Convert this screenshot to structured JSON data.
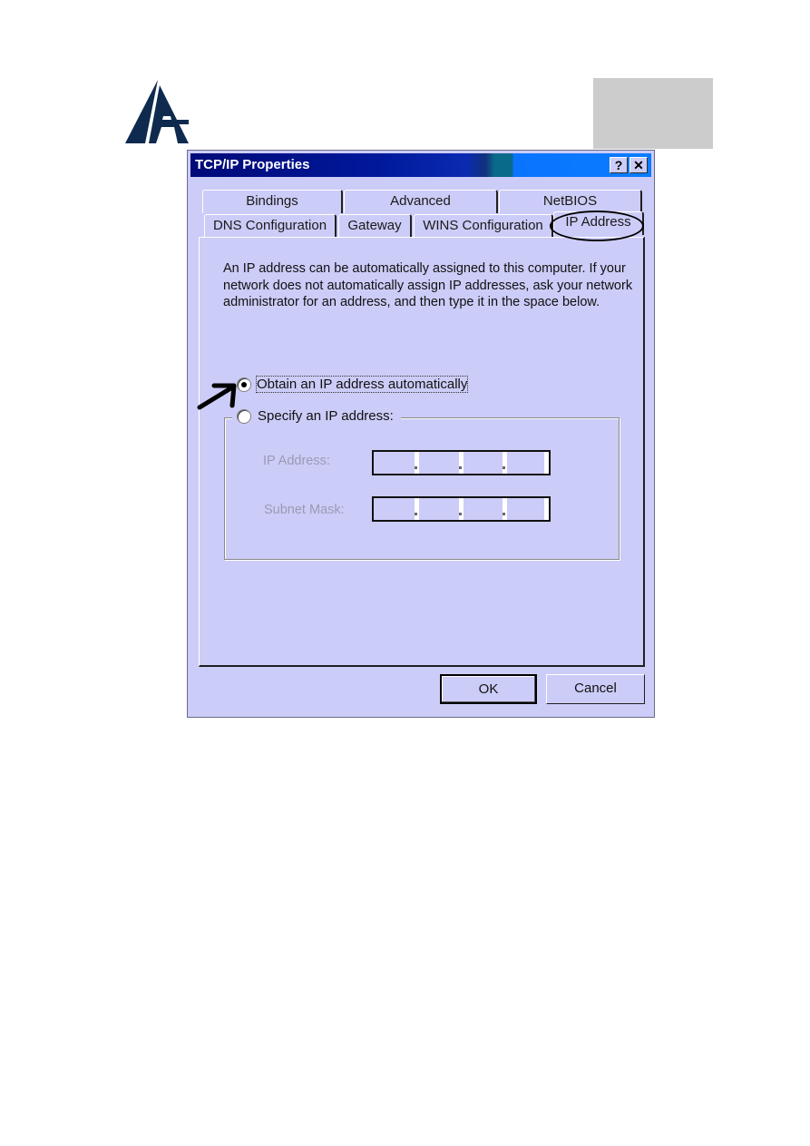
{
  "header": {
    "logo_icon": "atlantis-logo-icon",
    "gray_box": "placeholder-block"
  },
  "dialog": {
    "title": "TCP/IP Properties",
    "help_label": "?",
    "close_label": "✕",
    "tabs_row1": [
      {
        "label": "Bindings"
      },
      {
        "label": "Advanced"
      },
      {
        "label": "NetBIOS"
      }
    ],
    "tabs_row2": [
      {
        "label": "DNS Configuration"
      },
      {
        "label": "Gateway"
      },
      {
        "label": "WINS Configuration"
      },
      {
        "label": "IP Address",
        "active": true
      }
    ],
    "description": "An IP address can be automatically assigned to this computer. If your network does not automatically assign IP addresses, ask your network administrator for an address, and then type it in the space below.",
    "options": {
      "obtain_auto": {
        "label": "Obtain an IP address automatically",
        "checked": true
      },
      "specify": {
        "label": "Specify an IP address:",
        "checked": false
      }
    },
    "fields": {
      "ip_address": {
        "label": "IP Address:",
        "value": [
          "",
          "",
          "",
          ""
        ],
        "disabled": true
      },
      "subnet_mask": {
        "label": "Subnet Mask:",
        "value": [
          "",
          "",
          "",
          ""
        ],
        "disabled": true
      }
    },
    "buttons": {
      "ok": "OK",
      "cancel": "Cancel"
    },
    "annotations": {
      "arrow": "arrow-pointing-to-obtain-option",
      "ellipse": "circle-around-ip-address-tab"
    }
  },
  "colors": {
    "dialog_bg": "#ccccf8",
    "titlebar_start": "#000a78",
    "titlebar_end": "#0a7cff",
    "disabled_text": "#9a9ab4"
  }
}
